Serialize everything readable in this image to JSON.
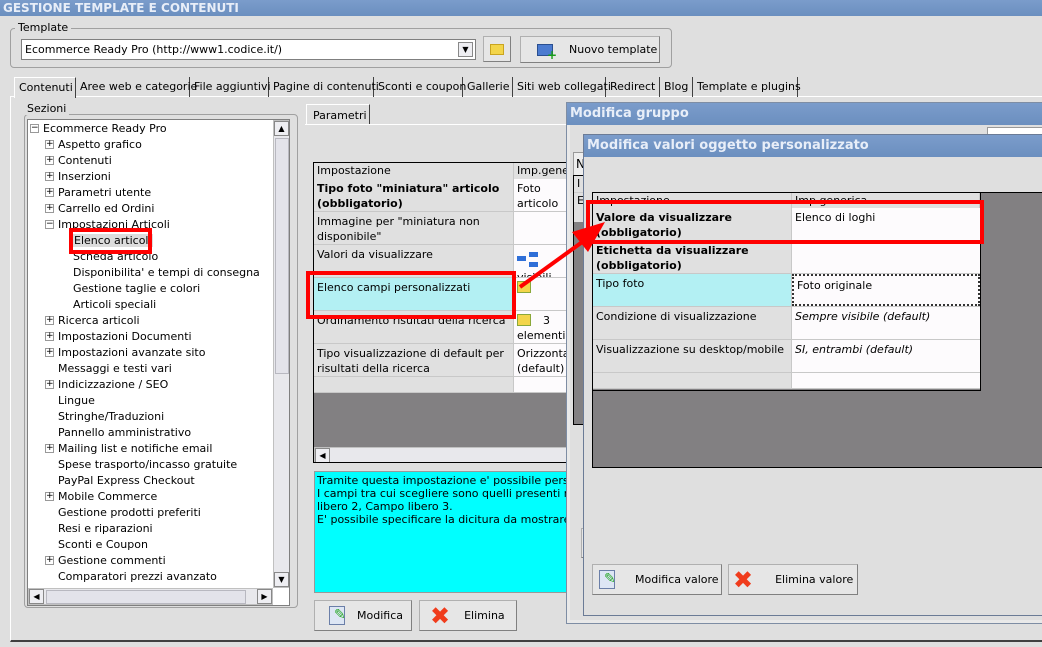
{
  "window": {
    "title": "GESTIONE TEMPLATE E CONTENUTI"
  },
  "template": {
    "label": "Template",
    "selected": "Ecommerce Ready Pro (http://www1.codice.it/)",
    "new_button": "Nuovo template"
  },
  "tabs": [
    "Contenuti",
    "Aree web e categorie",
    "File aggiuntivi",
    "Pagine di contenuti",
    "Sconti e coupon",
    "Gallerie",
    "Siti web collegati",
    "Redirect",
    "Blog",
    "Template e plugins"
  ],
  "sections": {
    "label": "Sezioni",
    "root": "Ecommerce Ready Pro",
    "items": [
      {
        "label": "Aspetto grafico",
        "level": 1,
        "exp": "+"
      },
      {
        "label": "Contenuti",
        "level": 1,
        "exp": "+"
      },
      {
        "label": "Inserzioni",
        "level": 1,
        "exp": "+"
      },
      {
        "label": "Parametri utente",
        "level": 1,
        "exp": "+"
      },
      {
        "label": "Carrello ed Ordini",
        "level": 1,
        "exp": "+"
      },
      {
        "label": "Impostazioni Articoli",
        "level": 1,
        "exp": "-"
      },
      {
        "label": "Elenco articoli",
        "level": 2,
        "exp": "",
        "selected": true
      },
      {
        "label": "Scheda articolo",
        "level": 2,
        "exp": ""
      },
      {
        "label": "Disponibilita' e tempi di consegna",
        "level": 2,
        "exp": ""
      },
      {
        "label": "Gestione taglie e colori",
        "level": 2,
        "exp": ""
      },
      {
        "label": "Articoli speciali",
        "level": 2,
        "exp": ""
      },
      {
        "label": "Ricerca articoli",
        "level": 1,
        "exp": "+"
      },
      {
        "label": "Impostazioni Documenti",
        "level": 1,
        "exp": "+"
      },
      {
        "label": "Impostazioni avanzate sito",
        "level": 1,
        "exp": "+"
      },
      {
        "label": "Messaggi e testi vari",
        "level": 1,
        "exp": ""
      },
      {
        "label": "Indicizzazione / SEO",
        "level": 1,
        "exp": "+"
      },
      {
        "label": "Lingue",
        "level": 1,
        "exp": ""
      },
      {
        "label": "Stringhe/Traduzioni",
        "level": 1,
        "exp": ""
      },
      {
        "label": "Pannello amministrativo",
        "level": 1,
        "exp": ""
      },
      {
        "label": "Mailing list e notifiche email",
        "level": 1,
        "exp": "+"
      },
      {
        "label": "Spese trasporto/incasso gratuite",
        "level": 1,
        "exp": ""
      },
      {
        "label": "PayPal Express Checkout",
        "level": 1,
        "exp": ""
      },
      {
        "label": "Mobile Commerce",
        "level": 1,
        "exp": "+"
      },
      {
        "label": "Gestione prodotti preferiti",
        "level": 1,
        "exp": ""
      },
      {
        "label": "Resi e riparazioni",
        "level": 1,
        "exp": ""
      },
      {
        "label": "Sconti e Coupon",
        "level": 1,
        "exp": ""
      },
      {
        "label": "Gestione commenti",
        "level": 1,
        "exp": "+"
      },
      {
        "label": "Comparatori prezzi avanzato",
        "level": 1,
        "exp": ""
      }
    ]
  },
  "params": {
    "tab": "Parametri",
    "headers": [
      "Impostazione",
      "Imp.generica"
    ],
    "rows": [
      {
        "name": "Tipo foto \"miniatura\" articolo (obbligatorio)",
        "value": "Foto articolo miniatura",
        "bold": true
      },
      {
        "name": "Immagine per \"miniatura non disponibile\"",
        "value": ""
      },
      {
        "name": "Valori da visualizzare",
        "value": "visibili",
        "icon": "tree-icon"
      },
      {
        "name": "Elenco campi personalizzati",
        "value": "",
        "icon": "folder-icon",
        "selected": true
      },
      {
        "name": "Ordinamento risultati della ricerca",
        "value": "3 elementi",
        "icon": "folder-icon"
      },
      {
        "name": "Tipo visualizzazione di default per risultati della ricerca",
        "value": "Orizzontale (default)"
      }
    ],
    "description": [
      "Tramite questa impostazione e' possibile personalizzare",
      "I campi tra cui scegliere sono quelli presenti nell'anagrafica",
      "libero 2, Campo libero 3.",
      "E' possibile specificare la dicitura da mostrare a fianco"
    ],
    "edit_button": "Modifica",
    "delete_button": "Elimina"
  },
  "dialog_group": {
    "title": "Modifica gruppo",
    "partial": [
      "N",
      "I",
      "E"
    ]
  },
  "dialog_values": {
    "title": "Modifica valori oggetto personalizzato",
    "headers": [
      "Impostazione",
      "Imp.generica"
    ],
    "rows": [
      {
        "name": "Valore da visualizzare (obbligatorio)",
        "value": "Elenco di loghi",
        "bold": true
      },
      {
        "name": "Etichetta da visualizzare (obbligatorio)",
        "value": "",
        "bold": true
      },
      {
        "name": "Tipo foto",
        "value": "Foto originale",
        "selected": true
      },
      {
        "name": "Condizione di visualizzazione",
        "value": "Sempre visibile (default)",
        "italic": true
      },
      {
        "name": "Visualizzazione su desktop/mobile",
        "value": "SI, entrambi (default)",
        "italic": true
      }
    ],
    "edit_button": "Modifica valore",
    "delete_button": "Elimina valore"
  },
  "colors": {
    "highlight": "#ff0000",
    "selected_row": "#b3f0f3",
    "description_bg": "#00ffff",
    "title_bar": "#6b8fbf"
  }
}
